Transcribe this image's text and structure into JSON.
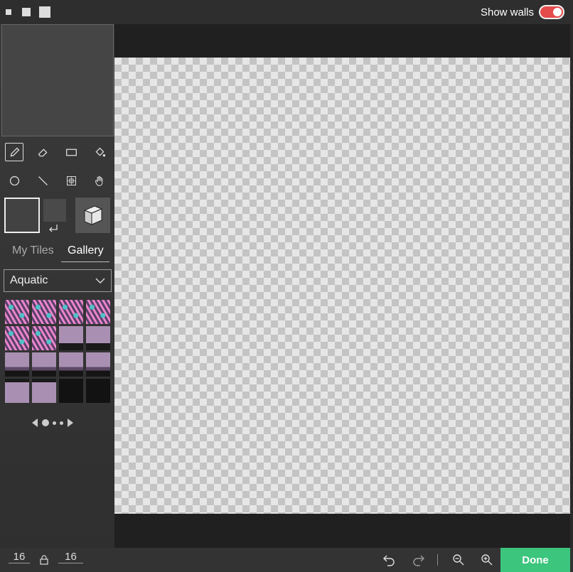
{
  "topbar": {
    "show_walls_label": "Show walls",
    "show_walls_on": true,
    "toggle_color": "#e44b4b"
  },
  "sidebar": {
    "tools_row1": [
      "pencil-icon",
      "eraser-icon",
      "rectangle-icon",
      "fill-bucket-icon"
    ],
    "tools_row2": [
      "circle-icon",
      "line-icon",
      "grid-select-icon",
      "hand-icon"
    ],
    "active_tool": "pencil-icon",
    "tabs": {
      "my_tiles": "My Tiles",
      "gallery": "Gallery",
      "active": "Gallery"
    },
    "tileset_select": {
      "value": "Aquatic"
    },
    "pager": {
      "pages": 3,
      "current": 1
    }
  },
  "bottom": {
    "width": "16",
    "height": "16",
    "done_label": "Done",
    "done_color": "#3bc57d"
  }
}
